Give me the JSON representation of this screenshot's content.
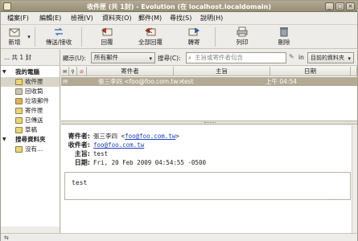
{
  "window": {
    "title": "收件匣 (共 1封) - Evolution (在 localhost.localdomain)",
    "controls": [
      "_",
      "□",
      "✕"
    ]
  },
  "menu": [
    "檔案(F)",
    "編輯(E)",
    "檢視(V)",
    "資料夾(O)",
    "郵件(M)",
    "尋找(S)",
    "說明(H)"
  ],
  "toolbar": {
    "new": "新增",
    "send_receive": "傳送/接收",
    "reply": "回覆",
    "reply_all": "全部回覆",
    "forward": "轉寄",
    "print": "列印",
    "delete": "刪除"
  },
  "left": {
    "header": "... 共 1 封",
    "tree": [
      {
        "label": "我的電腦",
        "kind": "group"
      },
      {
        "label": "收件匣",
        "kind": "item",
        "selected": true
      },
      {
        "label": "回收筒",
        "kind": "item"
      },
      {
        "label": "垃圾郵件",
        "kind": "item"
      },
      {
        "label": "寄件匣",
        "kind": "item"
      },
      {
        "label": "已傳送",
        "kind": "item"
      },
      {
        "label": "草稿",
        "kind": "item"
      },
      {
        "label": "搜尋資料夾",
        "kind": "group"
      },
      {
        "label": "沒有...",
        "kind": "item"
      }
    ]
  },
  "filter": {
    "show_label": "顯示(U):",
    "show_value": "所有郵件",
    "search_label": "搜尋(C):",
    "search_placeholder": "主旨或寄件者包含",
    "in_label": "in",
    "scope_value": "目前的資料夾"
  },
  "list": {
    "columns": [
      "寄件者",
      "主旨",
      "日期"
    ],
    "rows": [
      {
        "from": "張三李四 <foo@foo.com.tw>",
        "subject": "test",
        "date": "上午 04:54"
      }
    ]
  },
  "preview": {
    "from_label": "寄件者:",
    "from_name": "張三李四",
    "from_email": "foo@foo.com.tw",
    "to_label": "收件者:",
    "to_email": "foo@foo.com.tw",
    "subject_label": "主旨:",
    "subject": "test",
    "date_label": "日期:",
    "date": "Fri, 20 Feb 2009 04:54:55 -0500",
    "body": "test"
  }
}
